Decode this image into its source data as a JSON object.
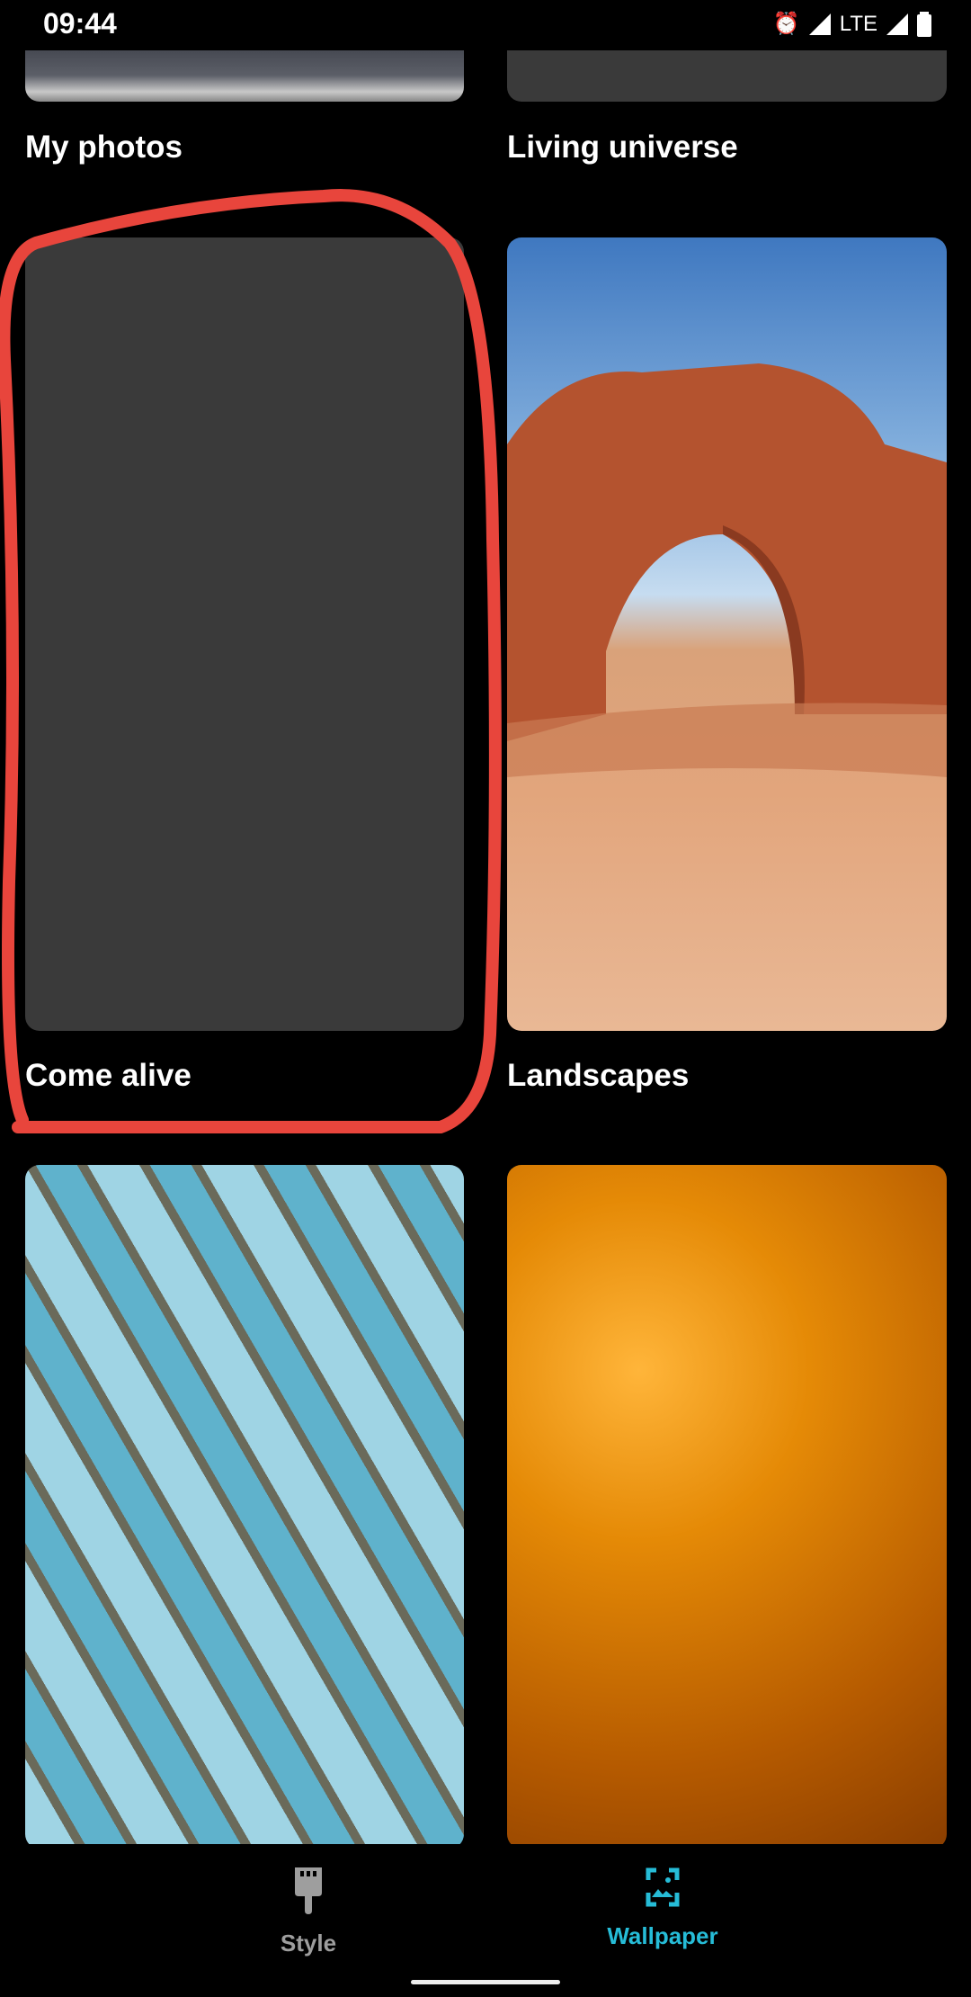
{
  "status_bar": {
    "time": "09:44",
    "network": "LTE",
    "icons": [
      "alarm-icon",
      "signal-icon",
      "signal-icon",
      "battery-icon"
    ]
  },
  "categories": [
    {
      "label": "My photos"
    },
    {
      "label": "Living universe"
    },
    {
      "label": "Come alive"
    },
    {
      "label": "Landscapes"
    },
    {
      "label": ""
    },
    {
      "label": ""
    }
  ],
  "bottom_nav": {
    "items": [
      {
        "label": "Style",
        "icon": "paintbrush-icon",
        "active": false
      },
      {
        "label": "Wallpaper",
        "icon": "wallpaper-icon",
        "active": true
      }
    ],
    "active_color": "#26bcd7",
    "inactive_color": "#9e9e9e"
  },
  "annotation_color": "#e8453c"
}
